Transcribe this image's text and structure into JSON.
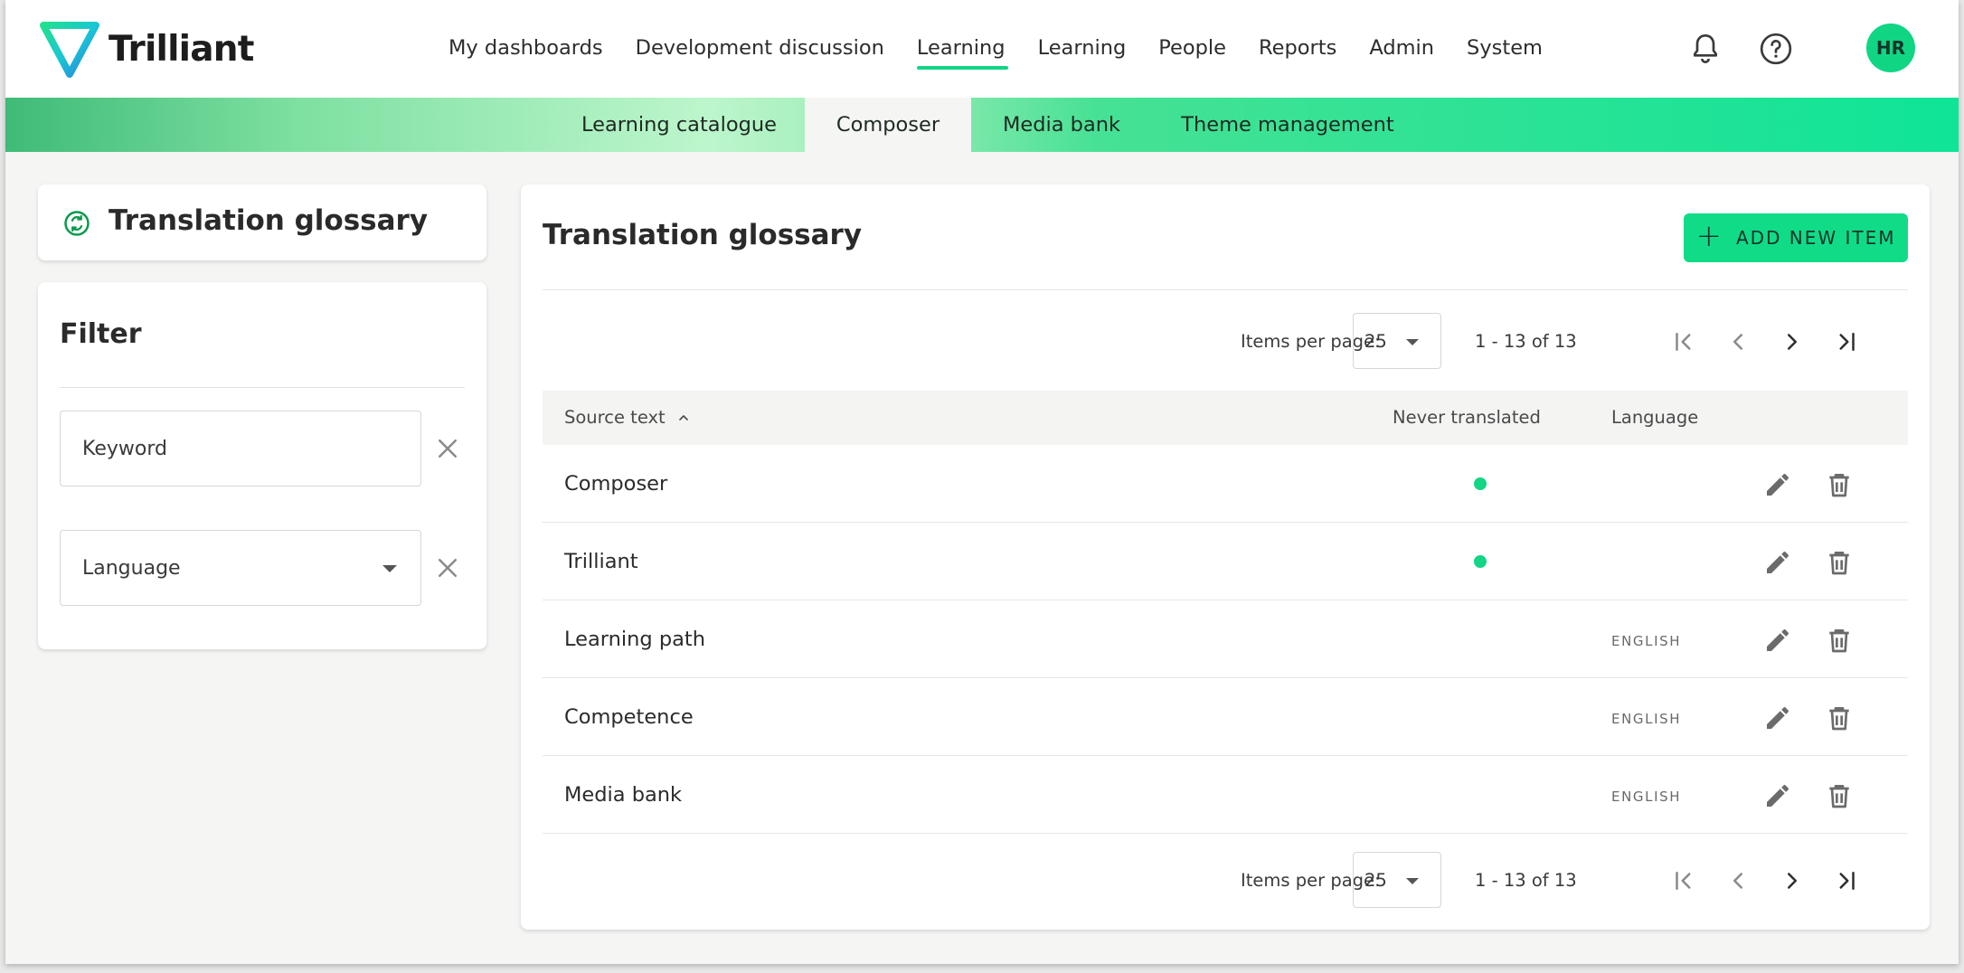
{
  "brand": {
    "name": "Trilliant"
  },
  "nav": {
    "items": [
      {
        "label": "My dashboards"
      },
      {
        "label": "Development discussion"
      },
      {
        "label": "Learning",
        "active": true
      },
      {
        "label": "Learning"
      },
      {
        "label": "People"
      },
      {
        "label": "Reports"
      },
      {
        "label": "Admin"
      },
      {
        "label": "System"
      }
    ]
  },
  "user": {
    "initials": "HR"
  },
  "icons": {
    "notifications": "bell-icon",
    "help": "help-circle-icon"
  },
  "subnav": {
    "tabs": [
      {
        "label": "Learning catalogue"
      },
      {
        "label": "Composer",
        "active": true
      },
      {
        "label": "Media bank"
      },
      {
        "label": "Theme management"
      }
    ]
  },
  "sidebar": {
    "title": "Translation glossary",
    "title_icon": "translate-cycle-icon",
    "filter": {
      "title": "Filter",
      "keyword_placeholder": "Keyword",
      "language_placeholder": "Language"
    }
  },
  "main": {
    "title": "Translation glossary",
    "add_button": "ADD NEW ITEM",
    "pagination": {
      "items_per_page_label": "Items per page:",
      "items_per_page": "25",
      "range": "1 - 13 of 13"
    },
    "columns": {
      "source": "Source text",
      "never_translated": "Never translated",
      "language": "Language"
    },
    "rows": [
      {
        "source": "Composer",
        "never_translated": true,
        "language": ""
      },
      {
        "source": "Trilliant",
        "never_translated": true,
        "language": ""
      },
      {
        "source": "Learning path",
        "never_translated": false,
        "language": "ENGLISH"
      },
      {
        "source": "Competence",
        "never_translated": false,
        "language": "ENGLISH"
      },
      {
        "source": "Media bank",
        "never_translated": false,
        "language": "ENGLISH"
      }
    ]
  },
  "colors": {
    "accent": "#10dc88",
    "indicator": "#12d585",
    "title_icon": "#0b9a4c"
  }
}
